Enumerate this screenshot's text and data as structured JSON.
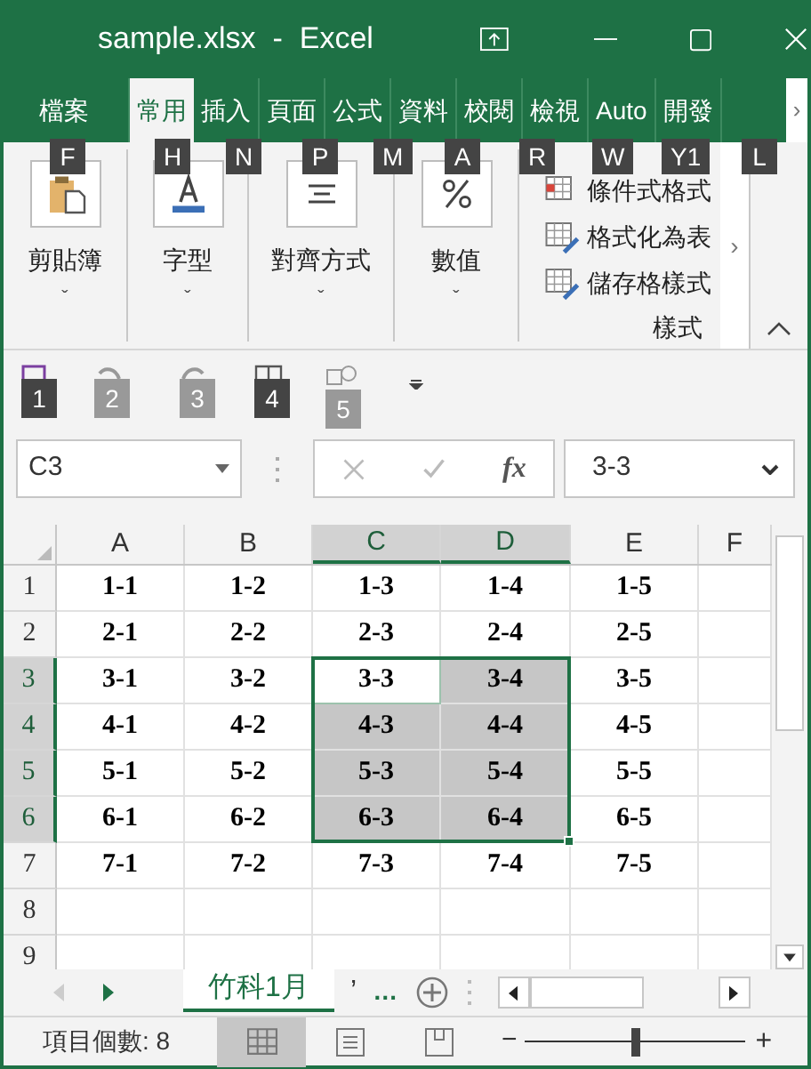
{
  "window": {
    "title": "sample.xlsx  -  Excel"
  },
  "ribbon_tabs": [
    {
      "label": "檔案",
      "selected": false
    },
    {
      "label": "常用",
      "selected": true
    },
    {
      "label": "插入",
      "selected": false
    },
    {
      "label": "頁面",
      "selected": false
    },
    {
      "label": "公式",
      "selected": false
    },
    {
      "label": "資料",
      "selected": false
    },
    {
      "label": "校閱",
      "selected": false
    },
    {
      "label": "檢視",
      "selected": false
    },
    {
      "label": "Auto",
      "selected": false
    },
    {
      "label": "開發",
      "selected": false
    }
  ],
  "ribbon_tabs_more": "›",
  "key_tips": [
    "F",
    "H",
    "N",
    "P",
    "M",
    "A",
    "R",
    "W",
    "Y1",
    "L"
  ],
  "ribbon_groups": [
    {
      "kind": "big",
      "label": "剪貼簿",
      "expand": "ˇ"
    },
    {
      "kind": "big",
      "label": "字型",
      "expand": "ˇ"
    },
    {
      "kind": "big",
      "label": "對齊方式",
      "expand": "ˇ"
    },
    {
      "kind": "big",
      "label": "數值",
      "expand": "ˇ"
    },
    {
      "kind": "list",
      "label": "樣式",
      "items": [
        "條件式格式",
        "格式化為表",
        "儲存格樣式"
      ]
    }
  ],
  "ribbon_more": "›",
  "quick_access": [
    {
      "key": "1",
      "disabled": false
    },
    {
      "key": "2",
      "disabled": true
    },
    {
      "key": "3",
      "disabled": true
    },
    {
      "key": "4",
      "disabled": false
    },
    {
      "key": "5",
      "disabled": true
    }
  ],
  "formula_bar": {
    "name_box": "C3",
    "fx": "fx",
    "value": "3-3"
  },
  "columns": [
    {
      "label": "A",
      "selected": false
    },
    {
      "label": "B",
      "selected": false
    },
    {
      "label": "C",
      "selected": true
    },
    {
      "label": "D",
      "selected": true
    },
    {
      "label": "E",
      "selected": false
    },
    {
      "label": "F",
      "selected": false
    }
  ],
  "rows": [
    {
      "header": "1",
      "selected": false,
      "cells": [
        {
          "value": "1-1",
          "selected": false
        },
        {
          "value": "1-2",
          "selected": false
        },
        {
          "value": "1-3",
          "selected": false
        },
        {
          "value": "1-4",
          "selected": false
        },
        {
          "value": "1-5",
          "selected": false
        }
      ]
    },
    {
      "header": "2",
      "selected": false,
      "cells": [
        {
          "value": "2-1",
          "selected": false
        },
        {
          "value": "2-2",
          "selected": false
        },
        {
          "value": "2-3",
          "selected": false
        },
        {
          "value": "2-4",
          "selected": false
        },
        {
          "value": "2-5",
          "selected": false
        }
      ]
    },
    {
      "header": "3",
      "selected": true,
      "cells": [
        {
          "value": "3-1",
          "selected": false
        },
        {
          "value": "3-2",
          "selected": false
        },
        {
          "value": "3-3",
          "selected": true,
          "active": true
        },
        {
          "value": "3-4",
          "selected": true
        },
        {
          "value": "3-5",
          "selected": false
        }
      ]
    },
    {
      "header": "4",
      "selected": true,
      "cells": [
        {
          "value": "4-1",
          "selected": false
        },
        {
          "value": "4-2",
          "selected": false
        },
        {
          "value": "4-3",
          "selected": true
        },
        {
          "value": "4-4",
          "selected": true
        },
        {
          "value": "4-5",
          "selected": false
        }
      ]
    },
    {
      "header": "5",
      "selected": true,
      "cells": [
        {
          "value": "5-1",
          "selected": false
        },
        {
          "value": "5-2",
          "selected": false
        },
        {
          "value": "5-3",
          "selected": true
        },
        {
          "value": "5-4",
          "selected": true
        },
        {
          "value": "5-5",
          "selected": false
        }
      ]
    },
    {
      "header": "6",
      "selected": true,
      "cells": [
        {
          "value": "6-1",
          "selected": false
        },
        {
          "value": "6-2",
          "selected": false
        },
        {
          "value": "6-3",
          "selected": true
        },
        {
          "value": "6-4",
          "selected": true
        },
        {
          "value": "6-5",
          "selected": false
        }
      ]
    },
    {
      "header": "7",
      "selected": false,
      "cells": [
        {
          "value": "7-1",
          "selected": false
        },
        {
          "value": "7-2",
          "selected": false
        },
        {
          "value": "7-3",
          "selected": false
        },
        {
          "value": "7-4",
          "selected": false
        },
        {
          "value": "7-5",
          "selected": false
        }
      ]
    },
    {
      "header": "8",
      "selected": false,
      "cells": []
    },
    {
      "header": "9",
      "selected": false,
      "cells": []
    }
  ],
  "sheet_tabs": [
    {
      "label": "竹科1月",
      "selected": true
    },
    {
      "label": "’",
      "selected": false
    }
  ],
  "sheet_tabs_more": "…",
  "status_bar": {
    "text": "項目個數: 8",
    "views": [
      {
        "selected": true
      },
      {
        "selected": false
      },
      {
        "selected": false
      }
    ],
    "zoom": {
      "minus": "−",
      "plus": "+",
      "level": 0.5
    }
  }
}
